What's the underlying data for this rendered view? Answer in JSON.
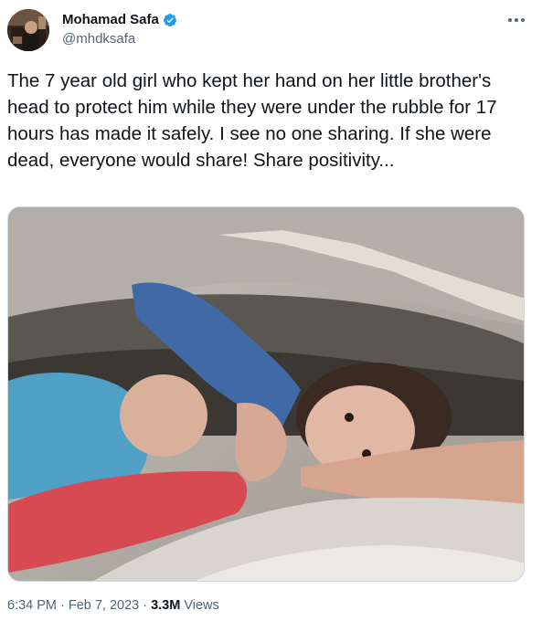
{
  "tweet": {
    "author": {
      "display_name": "Mohamad Safa",
      "handle": "@mhdksafa",
      "verified_icon": "verified-badge-icon",
      "avatar_icon": "avatar"
    },
    "more_icon": "more-options-icon",
    "text": "The 7 year old girl who kept her hand on her little brother's head to protect him while they were under the rubble for 17 hours has made it safely. I see no one sharing. If she were dead, everyone would share! Share positivity...",
    "media": {
      "kind": "photo"
    },
    "meta": {
      "time": "6:34 PM",
      "separator": "·",
      "date": "Feb 7, 2023",
      "separator2": "·",
      "views_count": "3.3M",
      "views_label": "Views"
    }
  },
  "colors": {
    "text": "#0f1419",
    "secondary": "#536471",
    "verified": "#1d9bf0",
    "border": "#cfd9de"
  }
}
